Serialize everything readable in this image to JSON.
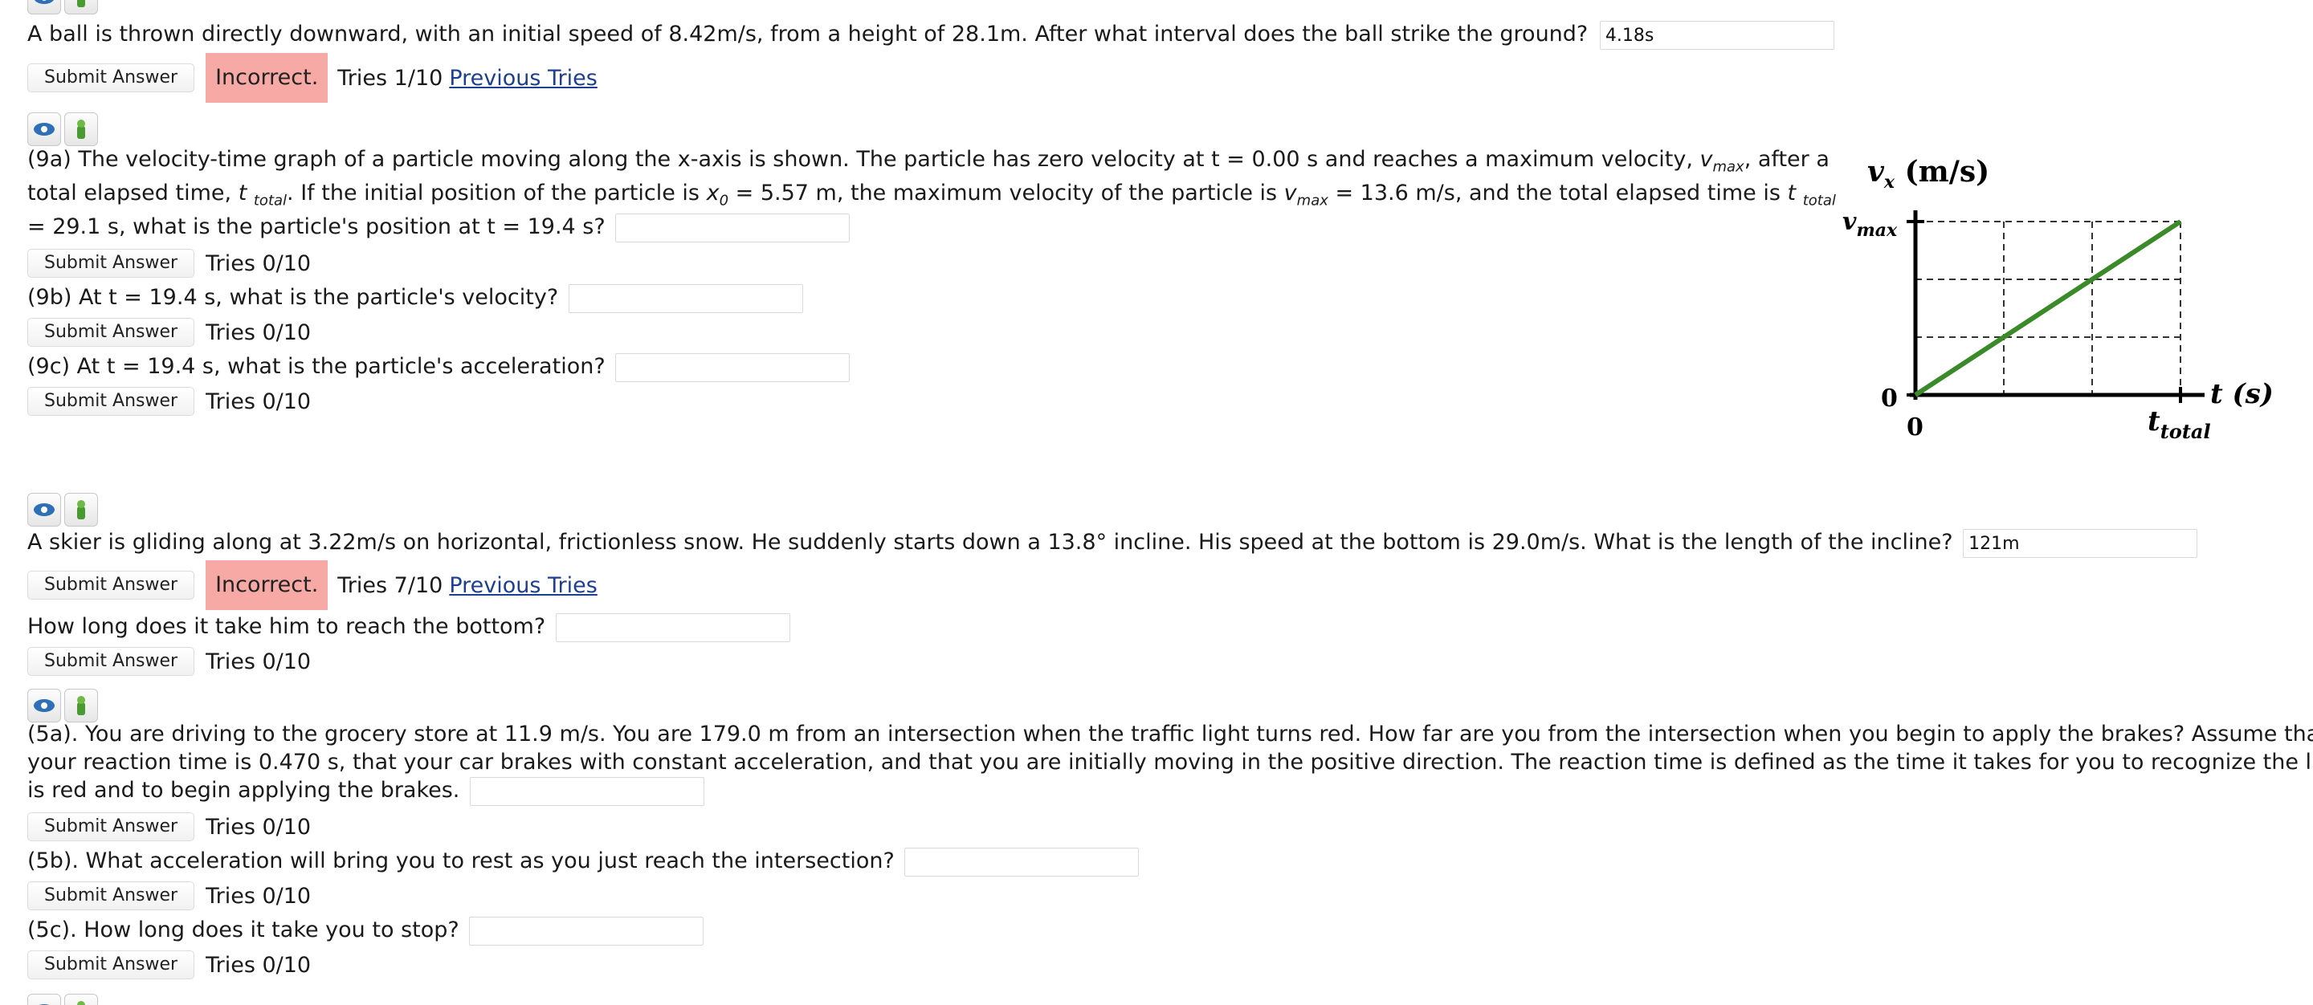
{
  "submit_label": "Submit Answer",
  "incorrect_label": "Incorrect.",
  "previous_tries_label": "Previous Tries",
  "q_ball": {
    "text": "A ball is thrown directly downward, with an initial speed of 8.42m/s, from a height of 28.1m. After what interval does the ball strike the ground?",
    "answer": "4.18s",
    "tries": "Tries 1/10"
  },
  "q9": {
    "a_p1": "(9a) The velocity-time graph of a particle moving along the x-axis is shown. The particle has zero velocity at t = 0.00 s and reaches a maximum velocity, ",
    "a_vmax_v": "v",
    "a_vmax_sub": "max",
    "a_p2": ", after a",
    "a_p3": "total elapsed time, ",
    "a_t": "t",
    "a_total_sub": "total",
    "a_p4": ". If the initial position of the particle is ",
    "a_x": "x",
    "a_x_sub": "0",
    "a_p5": " = 5.57 m, the maximum velocity of the particle is ",
    "a_p6": " = 13.6 m/s, and the total elapsed time is ",
    "a_p7": "= 29.1 s, what is the particle's position at t = 19.4 s?",
    "a_tries": "Tries 0/10",
    "b_text": "(9b) At t = 19.4 s, what is the particle's velocity?",
    "b_tries": "Tries 0/10",
    "c_text": "(9c) At t = 19.4 s, what is the particle's acceleration?",
    "c_tries": "Tries 0/10"
  },
  "graph": {
    "y_axis_label": "v",
    "y_axis_sub": "x",
    "y_axis_unit": " (m/s)",
    "vmax_label": "v",
    "vmax_sub": "max",
    "zero_y": "0",
    "zero_x": "0",
    "t_label": "t (s)",
    "ttotal_label": "t",
    "ttotal_sub": "total",
    "line_color": "#3a8a2a"
  },
  "q_skier": {
    "text": "A skier is gliding along at 3.22m/s on horizontal, frictionless snow. He suddenly starts down a 13.8° incline. His speed at the bottom is 29.0m/s. What is the length of the incline?",
    "answer": "121m",
    "tries": "Tries 7/10",
    "b_text": "How long does it take him to reach the bottom?",
    "b_tries": "Tries 0/10"
  },
  "q5": {
    "a_line1": "(5a). You are driving to the grocery store at 11.9 m/s. You are 179.0 m from an intersection when the traffic light turns red. How far are you from the intersection when you begin to apply the brakes? Assume that",
    "a_line2": "your reaction time is 0.470 s, that your car brakes with constant acceleration, and that you are initially moving in the positive direction. The reaction time is defined as the time it takes for you to recognize the light",
    "a_line3": "is red and to begin applying the brakes.",
    "a_tries": "Tries 0/10",
    "b_text": "(5b). What acceleration will bring you to rest as you just reach the intersection?",
    "b_tries": "Tries 0/10",
    "c_text": "(5c). How long does it take you to stop?",
    "c_tries": "Tries 0/10"
  }
}
